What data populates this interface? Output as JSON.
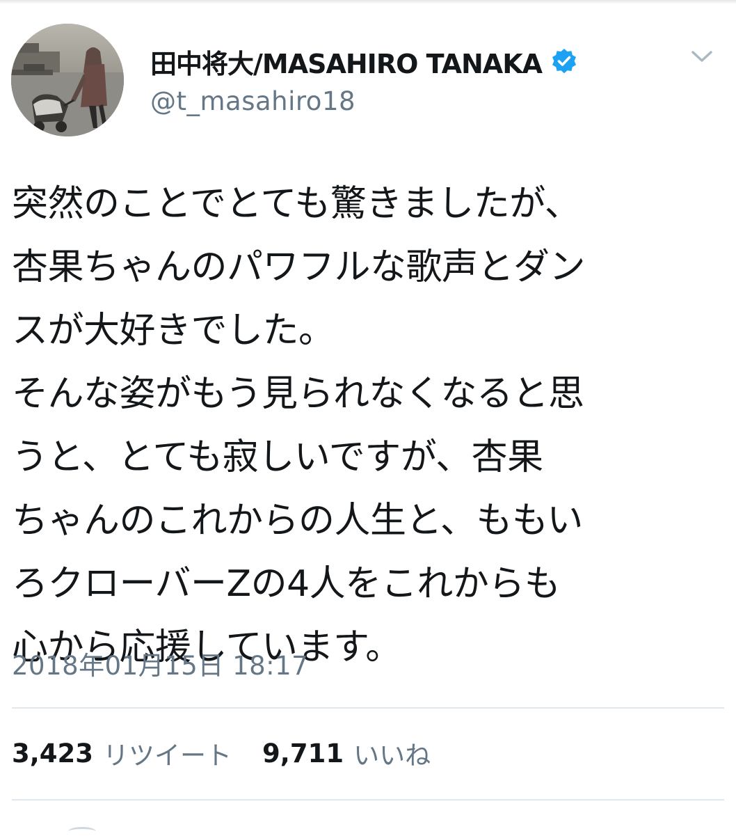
{
  "tweet": {
    "author": {
      "display_name": "田中将大/MASAHIRO TANAKA",
      "username": "@t_masahiro18",
      "verified": true
    },
    "text_lines": [
      "突然のことでとても驚きましたが、",
      "杏果ちゃんのパワフルな歌声とダン",
      "スが大好きでした。",
      "そんな姿がもう見られなくなると思",
      "うと、とても寂しいですが、杏果",
      "ちゃんのこれからの人生と、ももい",
      "ろクローバーZの4人をこれからも",
      "心から応援しています。"
    ],
    "timestamp": "2018年01月15日 18:17",
    "stats": {
      "retweets": {
        "count": "3,423",
        "label": "リツイート"
      },
      "likes": {
        "count": "9,711",
        "label": "いいね"
      }
    }
  },
  "colors": {
    "text_primary": "#14171a",
    "text_secondary": "#657786",
    "verified_blue": "#1da1f2",
    "divider": "#e1e8ed"
  },
  "icons": {
    "verified": "verified-badge-icon",
    "menu": "chevron-down-icon"
  }
}
